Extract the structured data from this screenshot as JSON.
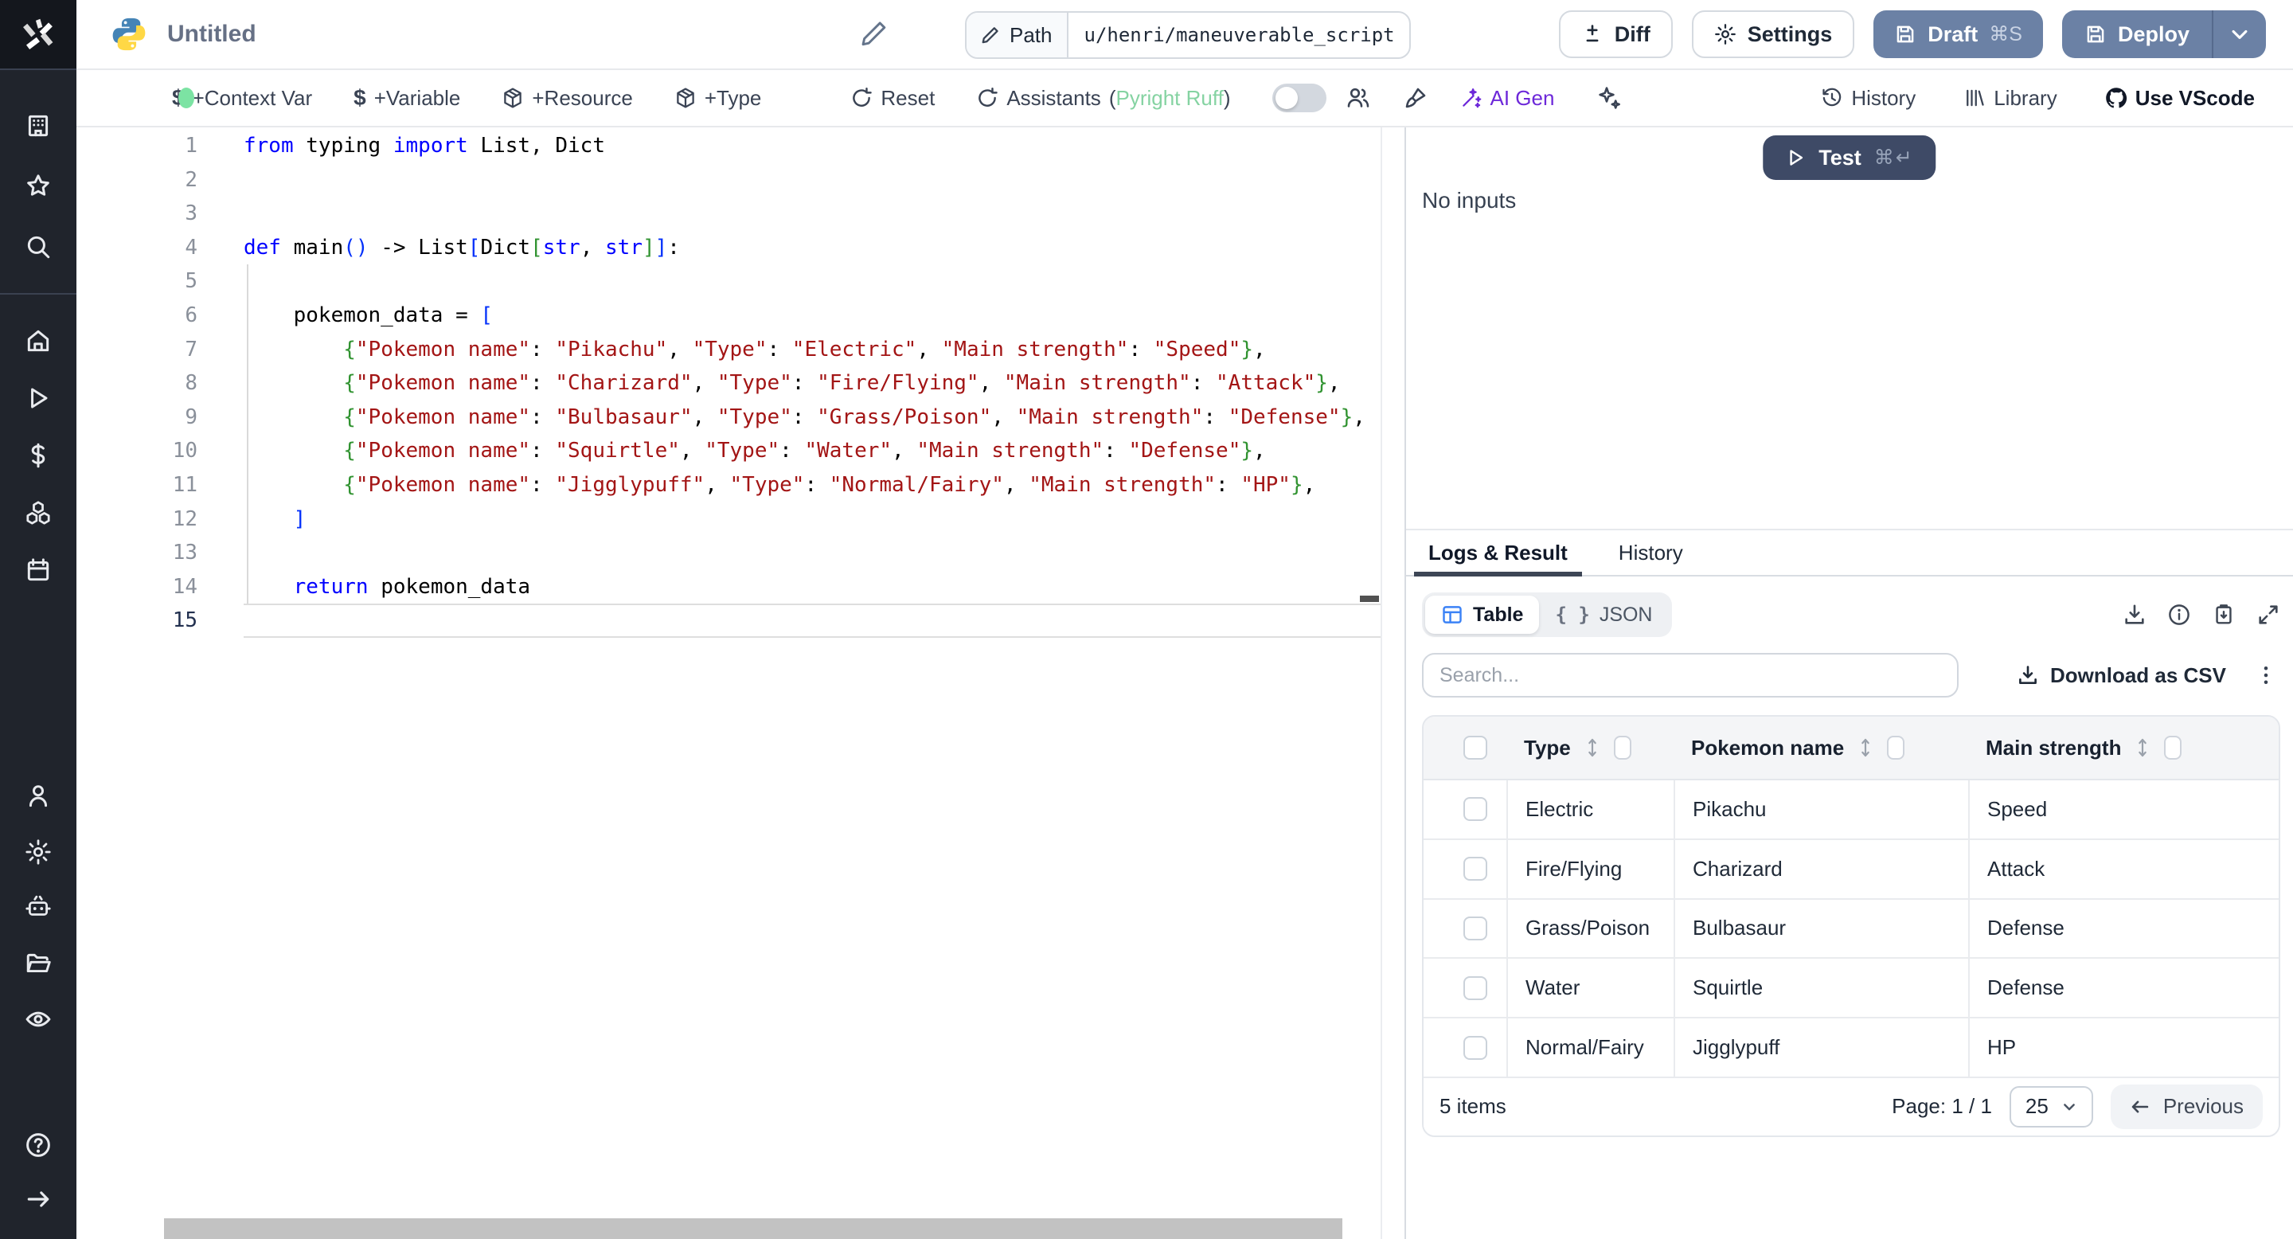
{
  "colors": {
    "accent_slate": "#6b81a5",
    "test_button": "#3e4a66",
    "ai_purple": "#6d28d9",
    "assistants_green": "#85d3a2",
    "status_dot_green": "#7ce3a3",
    "table_icon_blue": "#3b82f6"
  },
  "sidebar": {
    "items": [
      "windmill-logo",
      "building",
      "star",
      "search",
      "home",
      "play",
      "dollar",
      "cubes",
      "calendar",
      "user",
      "gear",
      "robot",
      "folder",
      "eye",
      "help",
      "arrow-right"
    ]
  },
  "topbar": {
    "title": "Untitled",
    "path_label": "Path",
    "path_value": "u/henri/maneuverable_script",
    "diff": "Diff",
    "settings": "Settings",
    "draft": "Draft",
    "draft_shortcut": "⌘S",
    "deploy": "Deploy"
  },
  "toolbar": {
    "context_var": "+Context Var",
    "variable": "+Variable",
    "resource": "+Resource",
    "type": "+Type",
    "reset": "Reset",
    "assistants": "Assistants",
    "assistants_open": "(",
    "assistants_lang": "Pyright Ruff",
    "assistants_close": ")",
    "ai_gen": "AI Gen",
    "history": "History",
    "library": "Library",
    "use_vscode": "Use VScode"
  },
  "editor": {
    "language": "python",
    "current_line": 15,
    "lines": [
      [
        [
          "kw",
          "from"
        ],
        [
          "pl",
          " typing "
        ],
        [
          "kw",
          "import"
        ],
        [
          "pl",
          " List, Dict"
        ]
      ],
      [],
      [],
      [
        [
          "kw",
          "def"
        ],
        [
          "pl",
          " main"
        ],
        [
          "b1",
          "()"
        ],
        [
          "pl",
          " -> List"
        ],
        [
          "b1",
          "["
        ],
        [
          "pl",
          "Dict"
        ],
        [
          "b2",
          "["
        ],
        [
          "kw",
          "str"
        ],
        [
          "pl",
          ", "
        ],
        [
          "kw",
          "str"
        ],
        [
          "b2",
          "]"
        ],
        [
          "b1",
          "]"
        ],
        [
          "pl",
          ":"
        ]
      ],
      [],
      [
        [
          "pl",
          "    pokemon_data = "
        ],
        [
          "b1",
          "["
        ]
      ],
      [
        [
          "pl",
          "        "
        ],
        [
          "b2",
          "{"
        ],
        [
          "st",
          "\"Pokemon name\""
        ],
        [
          "pl",
          ": "
        ],
        [
          "st",
          "\"Pikachu\""
        ],
        [
          "pl",
          ", "
        ],
        [
          "st",
          "\"Type\""
        ],
        [
          "pl",
          ": "
        ],
        [
          "st",
          "\"Electric\""
        ],
        [
          "pl",
          ", "
        ],
        [
          "st",
          "\"Main strength\""
        ],
        [
          "pl",
          ": "
        ],
        [
          "st",
          "\"Speed\""
        ],
        [
          "b2",
          "}"
        ],
        [
          "pl",
          ","
        ]
      ],
      [
        [
          "pl",
          "        "
        ],
        [
          "b2",
          "{"
        ],
        [
          "st",
          "\"Pokemon name\""
        ],
        [
          "pl",
          ": "
        ],
        [
          "st",
          "\"Charizard\""
        ],
        [
          "pl",
          ", "
        ],
        [
          "st",
          "\"Type\""
        ],
        [
          "pl",
          ": "
        ],
        [
          "st",
          "\"Fire/Flying\""
        ],
        [
          "pl",
          ", "
        ],
        [
          "st",
          "\"Main strength\""
        ],
        [
          "pl",
          ": "
        ],
        [
          "st",
          "\"Attack\""
        ],
        [
          "b2",
          "}"
        ],
        [
          "pl",
          ","
        ]
      ],
      [
        [
          "pl",
          "        "
        ],
        [
          "b2",
          "{"
        ],
        [
          "st",
          "\"Pokemon name\""
        ],
        [
          "pl",
          ": "
        ],
        [
          "st",
          "\"Bulbasaur\""
        ],
        [
          "pl",
          ", "
        ],
        [
          "st",
          "\"Type\""
        ],
        [
          "pl",
          ": "
        ],
        [
          "st",
          "\"Grass/Poison\""
        ],
        [
          "pl",
          ", "
        ],
        [
          "st",
          "\"Main strength\""
        ],
        [
          "pl",
          ": "
        ],
        [
          "st",
          "\"Defense\""
        ],
        [
          "b2",
          "}"
        ],
        [
          "pl",
          ","
        ]
      ],
      [
        [
          "pl",
          "        "
        ],
        [
          "b2",
          "{"
        ],
        [
          "st",
          "\"Pokemon name\""
        ],
        [
          "pl",
          ": "
        ],
        [
          "st",
          "\"Squirtle\""
        ],
        [
          "pl",
          ", "
        ],
        [
          "st",
          "\"Type\""
        ],
        [
          "pl",
          ": "
        ],
        [
          "st",
          "\"Water\""
        ],
        [
          "pl",
          ", "
        ],
        [
          "st",
          "\"Main strength\""
        ],
        [
          "pl",
          ": "
        ],
        [
          "st",
          "\"Defense\""
        ],
        [
          "b2",
          "}"
        ],
        [
          "pl",
          ","
        ]
      ],
      [
        [
          "pl",
          "        "
        ],
        [
          "b2",
          "{"
        ],
        [
          "st",
          "\"Pokemon name\""
        ],
        [
          "pl",
          ": "
        ],
        [
          "st",
          "\"Jigglypuff\""
        ],
        [
          "pl",
          ", "
        ],
        [
          "st",
          "\"Type\""
        ],
        [
          "pl",
          ": "
        ],
        [
          "st",
          "\"Normal/Fairy\""
        ],
        [
          "pl",
          ", "
        ],
        [
          "st",
          "\"Main strength\""
        ],
        [
          "pl",
          ": "
        ],
        [
          "st",
          "\"HP\""
        ],
        [
          "b2",
          "}"
        ],
        [
          "pl",
          ","
        ]
      ],
      [
        [
          "pl",
          "    "
        ],
        [
          "b1",
          "]"
        ]
      ],
      [],
      [
        [
          "pl",
          "    "
        ],
        [
          "kw",
          "return"
        ],
        [
          "pl",
          " pokemon_data"
        ]
      ],
      []
    ]
  },
  "run": {
    "test": "Test",
    "test_shortcut": "⌘↵",
    "no_inputs": "No inputs"
  },
  "results": {
    "tabs": [
      "Logs & Result",
      "History"
    ],
    "active_tab": "Logs & Result",
    "views": [
      "Table",
      "JSON"
    ],
    "active_view": "Table",
    "search_placeholder": "Search...",
    "download_csv": "Download as CSV"
  },
  "table": {
    "columns": [
      "Type",
      "Pokemon name",
      "Main strength"
    ],
    "rows": [
      [
        "Electric",
        "Pikachu",
        "Speed"
      ],
      [
        "Fire/Flying",
        "Charizard",
        "Attack"
      ],
      [
        "Grass/Poison",
        "Bulbasaur",
        "Defense"
      ],
      [
        "Water",
        "Squirtle",
        "Defense"
      ],
      [
        "Normal/Fairy",
        "Jigglypuff",
        "HP"
      ]
    ],
    "footer": {
      "items": "5 items",
      "page": "Page: 1 / 1",
      "page_size": "25",
      "previous": "Previous"
    }
  }
}
